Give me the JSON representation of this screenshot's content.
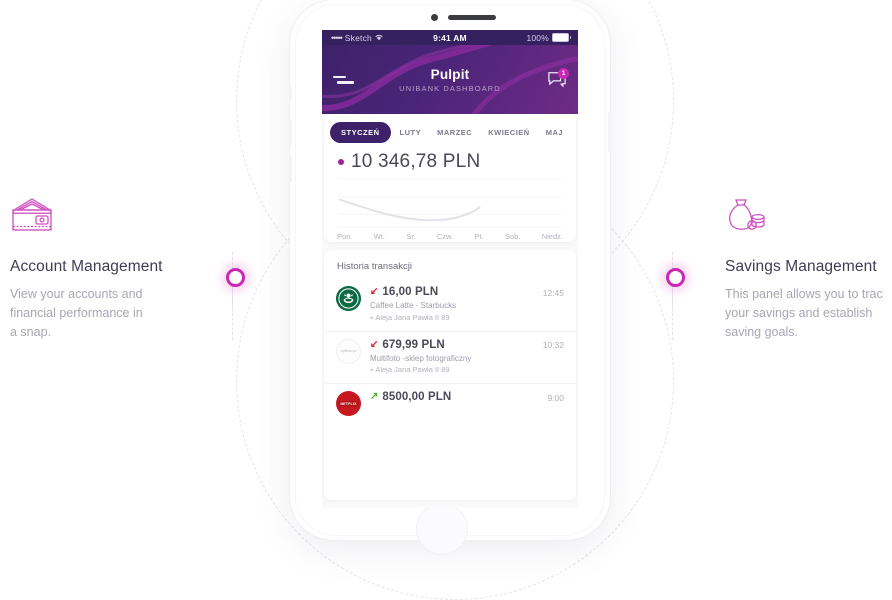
{
  "features": {
    "left": {
      "icon": "wallet-icon",
      "title": "Account Management",
      "desc": "View your accounts and\nfinancial performance in\na snap."
    },
    "right": {
      "icon": "money-bag-icon",
      "title": "Savings Management",
      "desc": "This panel allows you to trac\nyour savings and establish\nsaving goals."
    }
  },
  "phone": {
    "status_bar": {
      "carrier_dots": "•••••",
      "carrier": "Sketch",
      "wifi_icon": "wifi-icon",
      "time": "9:41 AM",
      "battery_pct": "100%"
    },
    "header": {
      "menu_icon": "hamburger-menu-icon",
      "title": "Pulpit",
      "subtitle": "UNIBANK DASHBOARD",
      "notification_icon": "chat-bubble-icon",
      "notification_count": "1"
    },
    "months": [
      {
        "label": "STYCZEŃ",
        "active": true
      },
      {
        "label": "LUTY",
        "active": false
      },
      {
        "label": "MARZEC",
        "active": false
      },
      {
        "label": "KWIECIEŃ",
        "active": false
      },
      {
        "label": "MAJ",
        "active": false
      }
    ],
    "balance": {
      "amount": "10 346,78 PLN",
      "bullet_color": "#a11f9e"
    },
    "chart": {
      "days": [
        "Pon.",
        "Wt.",
        "Śr.",
        "Czw.",
        "Pt.",
        "Sob.",
        "Niedz."
      ]
    },
    "transactions": {
      "title": "Historia transakcji",
      "rows": [
        {
          "logo": "starbucks-logo",
          "direction": "out",
          "arrow": "↙",
          "amount": "16,00 PLN",
          "time": "12:45",
          "desc": "Caffee Latte - Starbucks",
          "location": "Aleja Jana Pawła II 89"
        },
        {
          "logo": "multifoto-logo",
          "logo_text": "optifoto.pl",
          "direction": "out",
          "arrow": "↙",
          "amount": "679,99 PLN",
          "time": "10:32",
          "desc": "Multifoto -sklep fotograficzny",
          "location": "Aleja Jana Pawła II 89"
        },
        {
          "logo": "netflix-logo",
          "logo_text": "NETFLIX",
          "direction": "in",
          "arrow": "↗",
          "amount": "8500,00 PLN",
          "time": "9:00",
          "desc": "",
          "location": ""
        }
      ]
    }
  },
  "colors": {
    "accent": "#c828b4",
    "header_purple": "#3d2269",
    "text_dark": "#4b4857",
    "text_muted": "#a9a5b5",
    "negative": "#e0232d",
    "positive": "#4aa832"
  }
}
